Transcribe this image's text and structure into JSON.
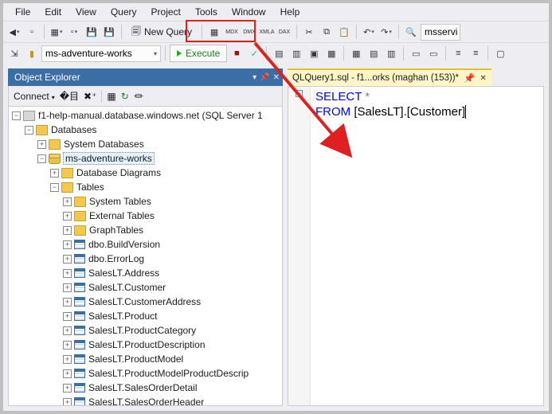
{
  "menu": [
    "File",
    "Edit",
    "View",
    "Query",
    "Project",
    "Tools",
    "Window",
    "Help"
  ],
  "toolbar1": {
    "new_query_label": "New Query",
    "combo_right": "msservi"
  },
  "toolbar2": {
    "db_combo": "ms-adventure-works",
    "execute_label": "Execute"
  },
  "object_explorer": {
    "title": "Object Explorer",
    "connect_label": "Connect",
    "server": "f1-help-manual.database.windows.net (SQL Server 1",
    "databases_label": "Databases",
    "sysdb_label": "System Databases",
    "userdb_label": "ms-adventure-works",
    "diagrams_label": "Database Diagrams",
    "tables_label": "Tables",
    "subfolders": [
      "System Tables",
      "External Tables",
      "GraphTables"
    ],
    "tables": [
      "dbo.BuildVersion",
      "dbo.ErrorLog",
      "SalesLT.Address",
      "SalesLT.Customer",
      "SalesLT.CustomerAddress",
      "SalesLT.Product",
      "SalesLT.ProductCategory",
      "SalesLT.ProductDescription",
      "SalesLT.ProductModel",
      "SalesLT.ProductModelProductDescrip",
      "SalesLT.SalesOrderDetail",
      "SalesLT.SalesOrderHeader"
    ]
  },
  "editor": {
    "tab_label": "QLQuery1.sql - f1...orks (maghan (153))*",
    "code": {
      "kw1": "SELECT",
      "star": " *",
      "kw2": "FROM",
      "space": " ",
      "obj": "[SalesLT].[Custome",
      "tail": "r]"
    }
  },
  "annotation": {
    "highlight_color": "#e02020"
  }
}
